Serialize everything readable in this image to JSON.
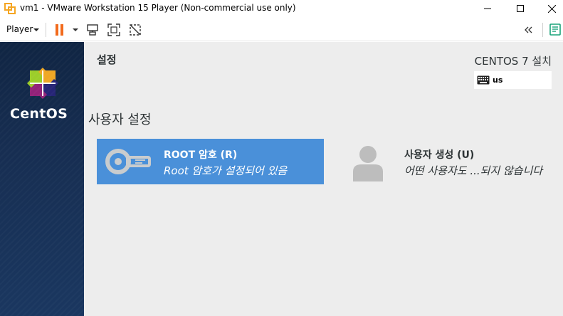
{
  "window": {
    "title": "vm1 - VMware Workstation 15 Player (Non-commercial use only)",
    "minimize": "—",
    "maximize": "☐",
    "close": "✕"
  },
  "toolbar": {
    "player_menu": "Player",
    "icons": [
      "pause-icon",
      "dropdown-icon",
      "send-ctrl-alt-del-icon",
      "fullscreen-icon",
      "unity-icon",
      "collapse-icon",
      "notes-icon"
    ]
  },
  "sidebar": {
    "brand": "CentOS"
  },
  "header": {
    "title": "설정",
    "install_title": "CENTOS 7 설치",
    "keyboard_layout": "us"
  },
  "section": {
    "title": "사용자 설정"
  },
  "spokes": {
    "root": {
      "name": "ROOT 암호 (R)",
      "status": "Root 암호가 설정되어 있음"
    },
    "user": {
      "name": "사용자 생성 (U)",
      "status": "어떤 사용자도 ...되지 않습니다"
    }
  },
  "colors": {
    "accent": "#4a90d9",
    "sidebar": "#172e52",
    "main_bg": "#ededed"
  }
}
